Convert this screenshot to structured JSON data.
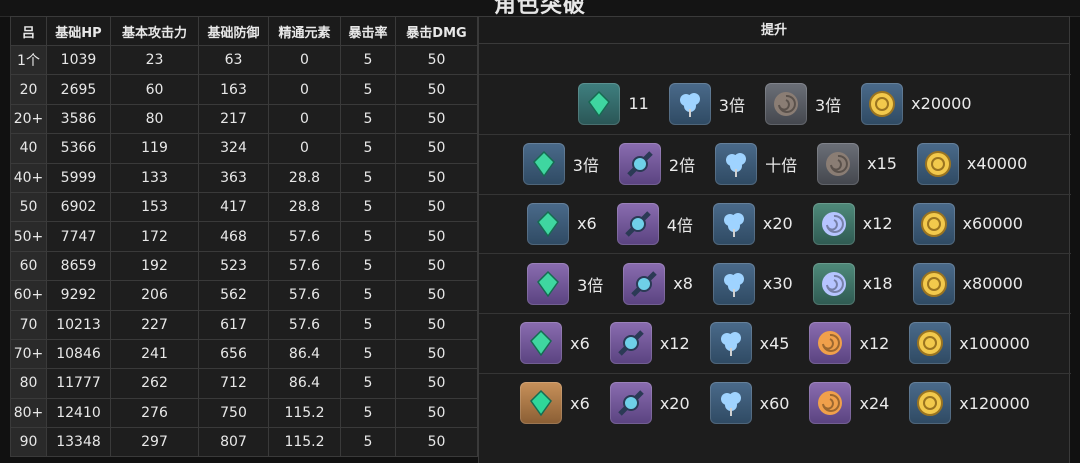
{
  "title": "角色突破",
  "table": {
    "headers": [
      "吕",
      "基础HP",
      "基本攻击力",
      "基础防御",
      "精通元素",
      "暴击率",
      "暴击DMG"
    ],
    "rows": [
      [
        "1个",
        "1039",
        "23",
        "63",
        "0",
        "5",
        "50"
      ],
      [
        "20",
        "2695",
        "60",
        "163",
        "0",
        "5",
        "50"
      ],
      [
        "20+",
        "3586",
        "80",
        "217",
        "0",
        "5",
        "50"
      ],
      [
        "40",
        "5366",
        "119",
        "324",
        "0",
        "5",
        "50"
      ],
      [
        "40+",
        "5999",
        "133",
        "363",
        "28.8",
        "5",
        "50"
      ],
      [
        "50",
        "6902",
        "153",
        "417",
        "28.8",
        "5",
        "50"
      ],
      [
        "50+",
        "7747",
        "172",
        "468",
        "57.6",
        "5",
        "50"
      ],
      [
        "60",
        "8659",
        "192",
        "523",
        "57.6",
        "5",
        "50"
      ],
      [
        "60+",
        "9292",
        "206",
        "562",
        "57.6",
        "5",
        "50"
      ],
      [
        "70",
        "10213",
        "227",
        "617",
        "57.6",
        "5",
        "50"
      ],
      [
        "70+",
        "10846",
        "241",
        "656",
        "86.4",
        "5",
        "50"
      ],
      [
        "80",
        "11777",
        "262",
        "712",
        "86.4",
        "5",
        "50"
      ],
      [
        "80+",
        "12410",
        "276",
        "750",
        "115.2",
        "5",
        "50"
      ],
      [
        "90",
        "13348",
        "297",
        "807",
        "115.2",
        "5",
        "50"
      ]
    ]
  },
  "ascension": {
    "header": "提升",
    "rows": [
      [
        {
          "icon": "gem-shards-icon",
          "qty": "11",
          "bg": "teal",
          "color": "#3fd6a0"
        },
        {
          "icon": "blue-flower-icon",
          "qty": "3倍",
          "bg": "blue",
          "color": "#9fd3ff"
        },
        {
          "icon": "slime-drop-icon",
          "qty": "3倍",
          "bg": "slate",
          "color": "#8a7d74"
        },
        {
          "icon": "mora-coin-icon",
          "qty": "x20000",
          "bg": "blue",
          "color": "#f2c94c"
        }
      ],
      [
        {
          "icon": "gem-sliver-icon",
          "qty": "3倍",
          "bg": "blue",
          "color": "#3fd6a0"
        },
        {
          "icon": "orb-boss-drop-icon",
          "qty": "2倍",
          "bg": "purple",
          "color": "#6fd0e8"
        },
        {
          "icon": "blue-flower-icon",
          "qty": "十倍",
          "bg": "blue",
          "color": "#9fd3ff"
        },
        {
          "icon": "slime-drop-icon",
          "qty": "x15",
          "bg": "slate",
          "color": "#8a7d74"
        },
        {
          "icon": "mora-coin-icon",
          "qty": "x40000",
          "bg": "blue",
          "color": "#f2c94c"
        }
      ],
      [
        {
          "icon": "gem-fragment-icon",
          "qty": "x6",
          "bg": "blue",
          "color": "#3fd6a0"
        },
        {
          "icon": "orb-boss-drop-icon",
          "qty": "4倍",
          "bg": "purple",
          "color": "#6fd0e8"
        },
        {
          "icon": "blue-flower-icon",
          "qty": "x20",
          "bg": "blue",
          "color": "#9fd3ff"
        },
        {
          "icon": "slime-condensate-icon",
          "qty": "x12",
          "bg": "green",
          "color": "#b6c4ff"
        },
        {
          "icon": "mora-coin-icon",
          "qty": "x60000",
          "bg": "blue",
          "color": "#f2c94c"
        }
      ],
      [
        {
          "icon": "gem-fragment-icon",
          "qty": "3倍",
          "bg": "purple",
          "color": "#3fd6a0"
        },
        {
          "icon": "orb-boss-drop-icon",
          "qty": "x8",
          "bg": "purple",
          "color": "#6fd0e8"
        },
        {
          "icon": "blue-flower-icon",
          "qty": "x30",
          "bg": "blue",
          "color": "#9fd3ff"
        },
        {
          "icon": "slime-condensate-icon",
          "qty": "x18",
          "bg": "green",
          "color": "#b6c4ff"
        },
        {
          "icon": "mora-coin-icon",
          "qty": "x80000",
          "bg": "blue",
          "color": "#f2c94c"
        }
      ],
      [
        {
          "icon": "gem-chunk-icon",
          "qty": "x6",
          "bg": "purple",
          "color": "#3fd6a0"
        },
        {
          "icon": "orb-boss-drop-icon",
          "qty": "x12",
          "bg": "purple",
          "color": "#6fd0e8"
        },
        {
          "icon": "blue-flower-icon",
          "qty": "x45",
          "bg": "blue",
          "color": "#9fd3ff"
        },
        {
          "icon": "slime-concentrate-icon",
          "qty": "x12",
          "bg": "purple",
          "color": "#f0a04b"
        },
        {
          "icon": "mora-coin-icon",
          "qty": "x100000",
          "bg": "blue",
          "color": "#f2c94c"
        }
      ],
      [
        {
          "icon": "gem-gemstone-icon",
          "qty": "x6",
          "bg": "gold",
          "color": "#2fd79a"
        },
        {
          "icon": "orb-boss-drop-icon",
          "qty": "x20",
          "bg": "purple",
          "color": "#6fd0e8"
        },
        {
          "icon": "blue-flower-icon",
          "qty": "x60",
          "bg": "blue",
          "color": "#9fd3ff"
        },
        {
          "icon": "slime-concentrate-icon",
          "qty": "x24",
          "bg": "purple",
          "color": "#f0a04b"
        },
        {
          "icon": "mora-coin-icon",
          "qty": "x120000",
          "bg": "blue",
          "color": "#f2c94c"
        }
      ]
    ]
  }
}
